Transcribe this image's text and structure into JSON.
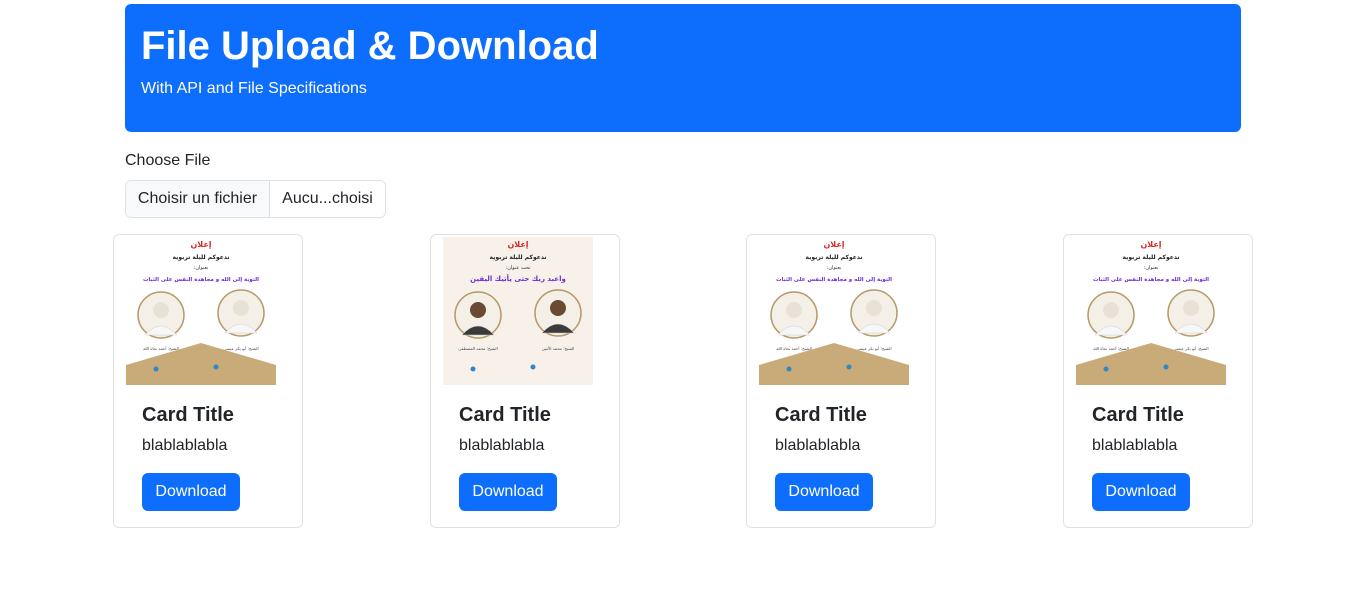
{
  "header": {
    "title": "File Upload & Download",
    "subtitle": "With API and File Specifications"
  },
  "upload": {
    "label": "Choose File",
    "button_label": "Choisir un fichier",
    "file_status": "Aucu...choisi"
  },
  "cards": [
    {
      "title": "Card Title",
      "text": "blablablabla",
      "button_label": "Download",
      "poster": {
        "heading": "إعلان",
        "line1": "ندعوكم لليلة تربوية",
        "line2": "بعنوان:",
        "topic": "التوبة إلى الله و مجاهدة النفس على الثبات",
        "speaker_left": "الشيخ: أحمد نجاة الله",
        "speaker_right": "الشيخ: أبو بكر عيسى"
      }
    },
    {
      "title": "Card Title",
      "text": "blablablabla",
      "button_label": "Download",
      "poster": {
        "heading": "إعلان",
        "line1": "ندعوكم لليلة تربوية",
        "line2": "تحت عنوان:",
        "topic": "واعبد ربك حتى يأتيك اليقين",
        "speaker_left": "الشيخ: محمد المصطفى",
        "speaker_right": "الشيخ: محمد الأمين"
      }
    },
    {
      "title": "Card Title",
      "text": "blablablabla",
      "button_label": "Download",
      "poster": {
        "heading": "إعلان",
        "line1": "ندعوكم لليلة تربوية",
        "line2": "بعنوان:",
        "topic": "التوبة إلى الله و مجاهدة النفس على الثبات",
        "speaker_left": "الشيخ: أحمد نجاة الله",
        "speaker_right": "الشيخ: أبو بكر عيسى"
      }
    },
    {
      "title": "Card Title",
      "text": "blablablabla",
      "button_label": "Download",
      "poster": {
        "heading": "إعلان",
        "line1": "ندعوكم لليلة تربوية",
        "line2": "بعنوان:",
        "topic": "التوبة إلى الله و مجاهدة النفس على الثبات",
        "speaker_left": "الشيخ: أحمد نجاة الله",
        "speaker_right": "الشيخ: أبو بكر عيسى"
      }
    }
  ],
  "colors": {
    "primary": "#0d6efd",
    "poster_heading": "#d62828",
    "poster_topic": "#6f2bd8",
    "poster_base": "#c9ab7a"
  }
}
